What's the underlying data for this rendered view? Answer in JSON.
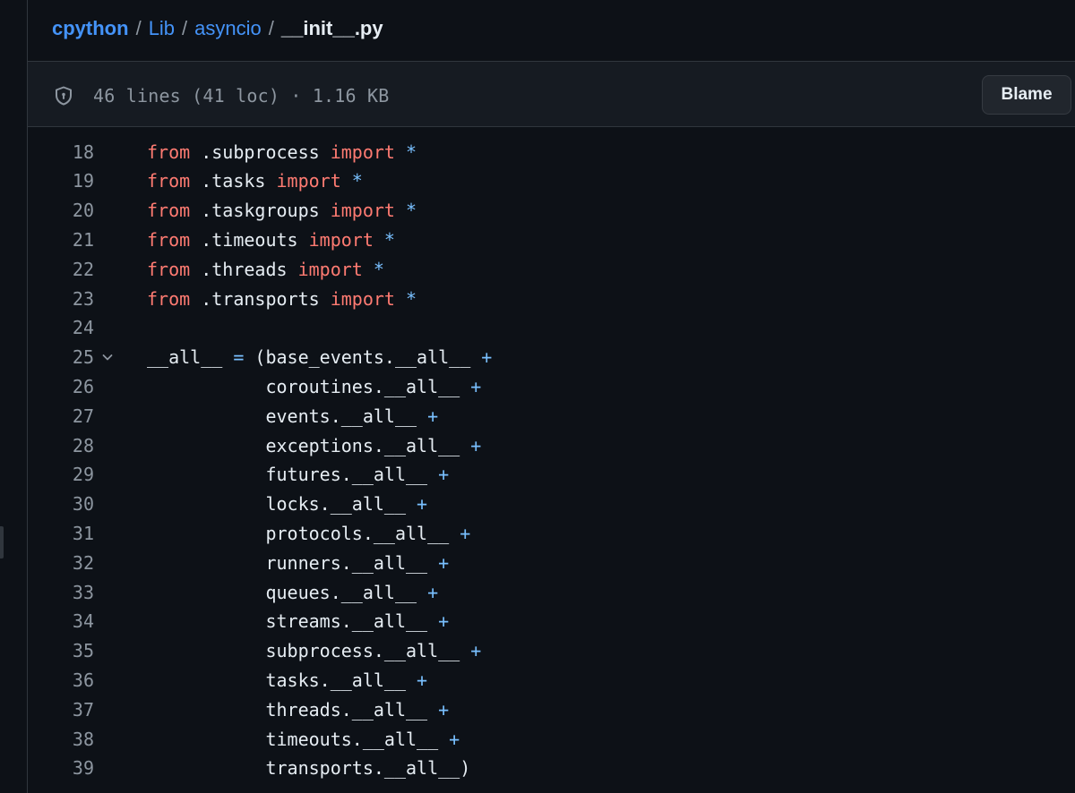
{
  "breadcrumb": {
    "root": "cpython",
    "parts": [
      "Lib",
      "asyncio"
    ],
    "separator": "/",
    "file": "__init__.py"
  },
  "file_header": {
    "info": "46 lines (41 loc) · 1.16 KB",
    "blame_label": "Blame",
    "icon": "shield-icon"
  },
  "code": {
    "lines": [
      {
        "n": "18",
        "tokens": [
          [
            "kw",
            "from"
          ],
          [
            "tx",
            " .subprocess "
          ],
          [
            "kw",
            "import"
          ],
          [
            "tx",
            " "
          ],
          [
            "op",
            "*"
          ]
        ]
      },
      {
        "n": "19",
        "tokens": [
          [
            "kw",
            "from"
          ],
          [
            "tx",
            " .tasks "
          ],
          [
            "kw",
            "import"
          ],
          [
            "tx",
            " "
          ],
          [
            "op",
            "*"
          ]
        ]
      },
      {
        "n": "20",
        "tokens": [
          [
            "kw",
            "from"
          ],
          [
            "tx",
            " .taskgroups "
          ],
          [
            "kw",
            "import"
          ],
          [
            "tx",
            " "
          ],
          [
            "op",
            "*"
          ]
        ]
      },
      {
        "n": "21",
        "tokens": [
          [
            "kw",
            "from"
          ],
          [
            "tx",
            " .timeouts "
          ],
          [
            "kw",
            "import"
          ],
          [
            "tx",
            " "
          ],
          [
            "op",
            "*"
          ]
        ]
      },
      {
        "n": "22",
        "tokens": [
          [
            "kw",
            "from"
          ],
          [
            "tx",
            " .threads "
          ],
          [
            "kw",
            "import"
          ],
          [
            "tx",
            " "
          ],
          [
            "op",
            "*"
          ]
        ]
      },
      {
        "n": "23",
        "tokens": [
          [
            "kw",
            "from"
          ],
          [
            "tx",
            " .transports "
          ],
          [
            "kw",
            "import"
          ],
          [
            "tx",
            " "
          ],
          [
            "op",
            "*"
          ]
        ]
      },
      {
        "n": "24",
        "tokens": []
      },
      {
        "n": "25",
        "fold": true,
        "tokens": [
          [
            "tx",
            "__all__ "
          ],
          [
            "op",
            "="
          ],
          [
            "tx",
            " (base_events.__all__ "
          ],
          [
            "op",
            "+"
          ]
        ]
      },
      {
        "n": "26",
        "tokens": [
          [
            "tx",
            "           coroutines.__all__ "
          ],
          [
            "op",
            "+"
          ]
        ]
      },
      {
        "n": "27",
        "tokens": [
          [
            "tx",
            "           events.__all__ "
          ],
          [
            "op",
            "+"
          ]
        ]
      },
      {
        "n": "28",
        "tokens": [
          [
            "tx",
            "           exceptions.__all__ "
          ],
          [
            "op",
            "+"
          ]
        ]
      },
      {
        "n": "29",
        "tokens": [
          [
            "tx",
            "           futures.__all__ "
          ],
          [
            "op",
            "+"
          ]
        ]
      },
      {
        "n": "30",
        "tokens": [
          [
            "tx",
            "           locks.__all__ "
          ],
          [
            "op",
            "+"
          ]
        ]
      },
      {
        "n": "31",
        "tokens": [
          [
            "tx",
            "           protocols.__all__ "
          ],
          [
            "op",
            "+"
          ]
        ]
      },
      {
        "n": "32",
        "tokens": [
          [
            "tx",
            "           runners.__all__ "
          ],
          [
            "op",
            "+"
          ]
        ]
      },
      {
        "n": "33",
        "tokens": [
          [
            "tx",
            "           queues.__all__ "
          ],
          [
            "op",
            "+"
          ]
        ]
      },
      {
        "n": "34",
        "tokens": [
          [
            "tx",
            "           streams.__all__ "
          ],
          [
            "op",
            "+"
          ]
        ]
      },
      {
        "n": "35",
        "tokens": [
          [
            "tx",
            "           subprocess.__all__ "
          ],
          [
            "op",
            "+"
          ]
        ]
      },
      {
        "n": "36",
        "tokens": [
          [
            "tx",
            "           tasks.__all__ "
          ],
          [
            "op",
            "+"
          ]
        ]
      },
      {
        "n": "37",
        "tokens": [
          [
            "tx",
            "           threads.__all__ "
          ],
          [
            "op",
            "+"
          ]
        ]
      },
      {
        "n": "38",
        "tokens": [
          [
            "tx",
            "           timeouts.__all__ "
          ],
          [
            "op",
            "+"
          ]
        ]
      },
      {
        "n": "39",
        "tokens": [
          [
            "tx",
            "           transports.__all__)"
          ]
        ]
      }
    ]
  },
  "colors": {
    "background": "#0d1117",
    "keyword": "#ff7b72",
    "operator": "#79c0ff",
    "link": "#4493f8",
    "line_number": "#8d96a0"
  }
}
